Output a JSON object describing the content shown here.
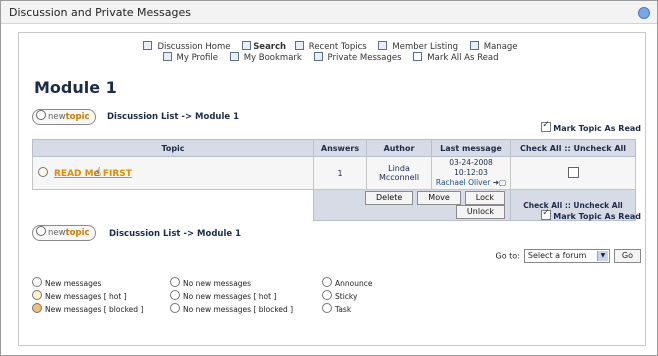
{
  "window": {
    "title": "Discussion and Private Messages"
  },
  "nav": {
    "row1": [
      "Discussion Home",
      "Search",
      "Recent Topics",
      "Member Listing",
      "Manage"
    ],
    "row2": [
      "My Profile",
      "My Bookmark",
      "Private Messages",
      "Mark All As Read"
    ]
  },
  "page": {
    "heading": "Module 1"
  },
  "newtopic": {
    "w1": "new",
    "w2": "topic"
  },
  "breadcrumb": {
    "top": "Discussion List -> Module 1",
    "bottom": "Discussion List -> Module 1"
  },
  "mark_topic": "Mark Topic As Read",
  "table": {
    "headers": [
      "Topic",
      "Answers",
      "Author",
      "Last message",
      "Check All :: Uncheck All"
    ],
    "rows": [
      {
        "topic": "READ Me FIRST",
        "answers": "1",
        "author": "Linda Mcconnell",
        "date": "03-24-2008 10:12:03",
        "last_author": "Rachael Oliver"
      }
    ],
    "buttons": [
      "Delete",
      "Move",
      "Lock",
      "Unlock"
    ],
    "check_all": "Check All :: Uncheck All"
  },
  "goto": {
    "label": "Go to:",
    "selected": "Select a forum",
    "button": "Go"
  },
  "legend": {
    "col1": [
      "New messages",
      "New messages [ hot ]",
      "New messages [ blocked ]"
    ],
    "col2": [
      "No new messages",
      "No new messages [ hot ]",
      "No new messages [ blocked ]"
    ],
    "col3": [
      "Announce",
      "Sticky",
      "Task"
    ]
  }
}
